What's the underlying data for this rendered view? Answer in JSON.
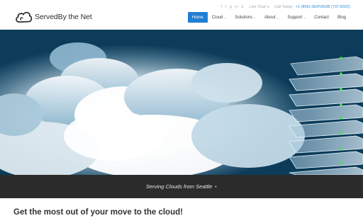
{
  "brand": {
    "name": "ServedBy the Net",
    "logo_icon": "cloud-logo-icon"
  },
  "utility_bar": {
    "social_icons": [
      "facebook-icon",
      "twitter-icon",
      "google-plus-icon",
      "linkedin-icon",
      "skype-icon"
    ],
    "live_chat": "Live Chat",
    "call_label": "Call Today:",
    "phone": "+1 (855)-SERVEDB (737-8332)"
  },
  "nav": {
    "items": [
      {
        "label": "Home",
        "active": true,
        "dropdown": false
      },
      {
        "label": "Cloud",
        "active": false,
        "dropdown": true
      },
      {
        "label": "Solutions",
        "active": false,
        "dropdown": true
      },
      {
        "label": "About",
        "active": false,
        "dropdown": true
      },
      {
        "label": "Support",
        "active": false,
        "dropdown": true
      },
      {
        "label": "Contact",
        "active": false,
        "dropdown": false
      },
      {
        "label": "Blog",
        "active": false,
        "dropdown": false
      }
    ]
  },
  "hero": {
    "image": "clouds-with-server-stack"
  },
  "tagline": {
    "text": "Serving Clouds from Seattle"
  },
  "intro": {
    "heading": "Get the most out of your move to the cloud!"
  },
  "colors": {
    "accent": "#1f7fd3",
    "phone": "#2a8fd6",
    "tagline_bg": "#2b2b2b",
    "server_led": "#3ee04a"
  }
}
